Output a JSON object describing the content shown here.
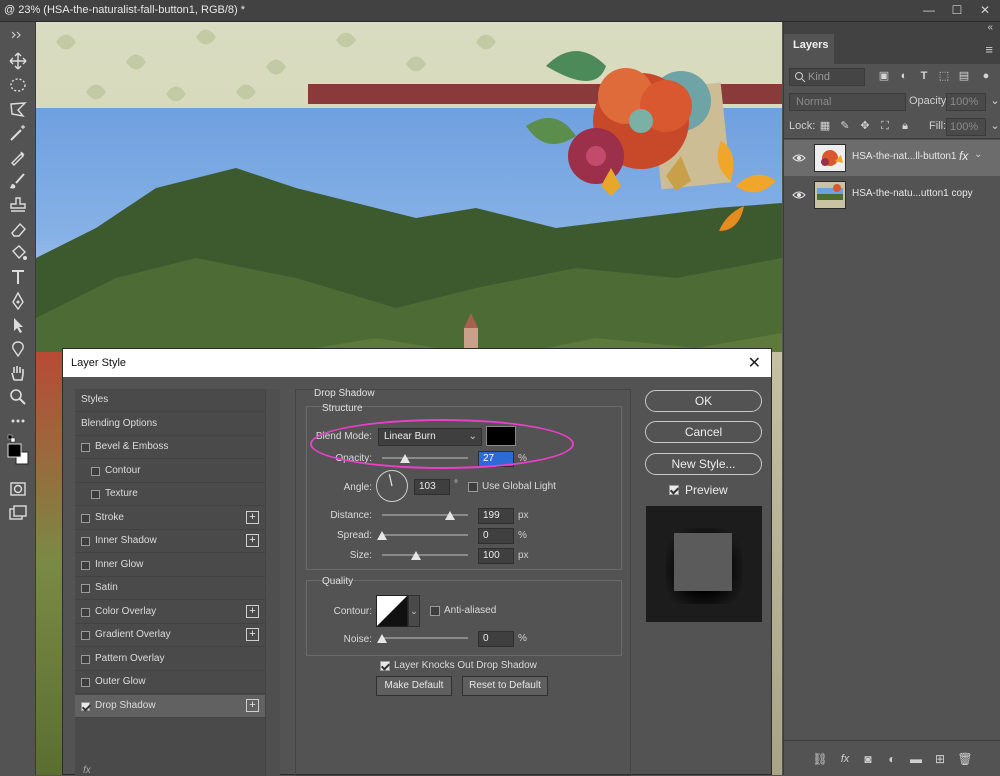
{
  "window": {
    "title": "@ 23% (HSA-the-naturalist-fall-button1, RGB/8) *",
    "minimize": "—",
    "maximize": "☐",
    "close": "✕"
  },
  "layers_panel": {
    "tab_label": "Layers",
    "collapse": "«",
    "menu": "≡",
    "filter_placeholder": "Kind",
    "blend_mode": "Normal",
    "opacity_label": "Opacity:",
    "opacity_value": "100%",
    "lock_label": "Lock:",
    "fill_label": "Fill:",
    "fill_value": "100%",
    "layers": [
      {
        "name": "HSA-the-nat...ll-button1",
        "fx": "fx",
        "selected": true
      },
      {
        "name": "HSA-the-natu...utton1 copy",
        "selected": false
      }
    ]
  },
  "dialog": {
    "title": "Layer Style",
    "close": "✕",
    "styles": [
      {
        "label": "Styles",
        "checkbox": false,
        "plus": false,
        "checked": false
      },
      {
        "label": "Blending Options",
        "checkbox": false,
        "plus": false,
        "checked": false
      },
      {
        "label": "Bevel & Emboss",
        "checkbox": true,
        "plus": false,
        "checked": false
      },
      {
        "label": "Contour",
        "checkbox": true,
        "plus": false,
        "checked": false,
        "indent": true
      },
      {
        "label": "Texture",
        "checkbox": true,
        "plus": false,
        "checked": false,
        "indent": true
      },
      {
        "label": "Stroke",
        "checkbox": true,
        "plus": true,
        "checked": false
      },
      {
        "label": "Inner Shadow",
        "checkbox": true,
        "plus": true,
        "checked": false
      },
      {
        "label": "Inner Glow",
        "checkbox": true,
        "plus": false,
        "checked": false
      },
      {
        "label": "Satin",
        "checkbox": true,
        "plus": false,
        "checked": false
      },
      {
        "label": "Color Overlay",
        "checkbox": true,
        "plus": true,
        "checked": false
      },
      {
        "label": "Gradient Overlay",
        "checkbox": true,
        "plus": true,
        "checked": false
      },
      {
        "label": "Pattern Overlay",
        "checkbox": true,
        "plus": false,
        "checked": false
      },
      {
        "label": "Outer Glow",
        "checkbox": true,
        "plus": false,
        "checked": false
      },
      {
        "label": "Drop Shadow",
        "checkbox": true,
        "plus": true,
        "checked": true,
        "selected": true
      }
    ],
    "footer_fx": "fx",
    "drop_shadow": {
      "section_title": "Drop Shadow",
      "structure_title": "Structure",
      "blend_mode_label": "Blend Mode:",
      "blend_mode_value": "Linear Burn",
      "shadow_color": "#000000",
      "opacity_label": "Opacity:",
      "opacity_value": "27",
      "opacity_unit": "%",
      "angle_label": "Angle:",
      "angle_value": "103",
      "angle_unit": "°",
      "use_global_light_label": "Use Global Light",
      "use_global_light": false,
      "distance_label": "Distance:",
      "distance_value": "199",
      "distance_unit": "px",
      "spread_label": "Spread:",
      "spread_value": "0",
      "spread_unit": "%",
      "size_label": "Size:",
      "size_value": "100",
      "size_unit": "px",
      "quality_title": "Quality",
      "contour_label": "Contour:",
      "anti_aliased_label": "Anti-aliased",
      "anti_aliased": false,
      "noise_label": "Noise:",
      "noise_value": "0",
      "noise_unit": "%",
      "knockout_label": "Layer Knocks Out Drop Shadow",
      "knockout": true,
      "make_default": "Make Default",
      "reset_default": "Reset to Default"
    },
    "buttons": {
      "ok": "OK",
      "cancel": "Cancel",
      "new_style": "New Style...",
      "preview_label": "Preview",
      "preview_checked": true
    },
    "highlight_color": "#e93fc9"
  }
}
